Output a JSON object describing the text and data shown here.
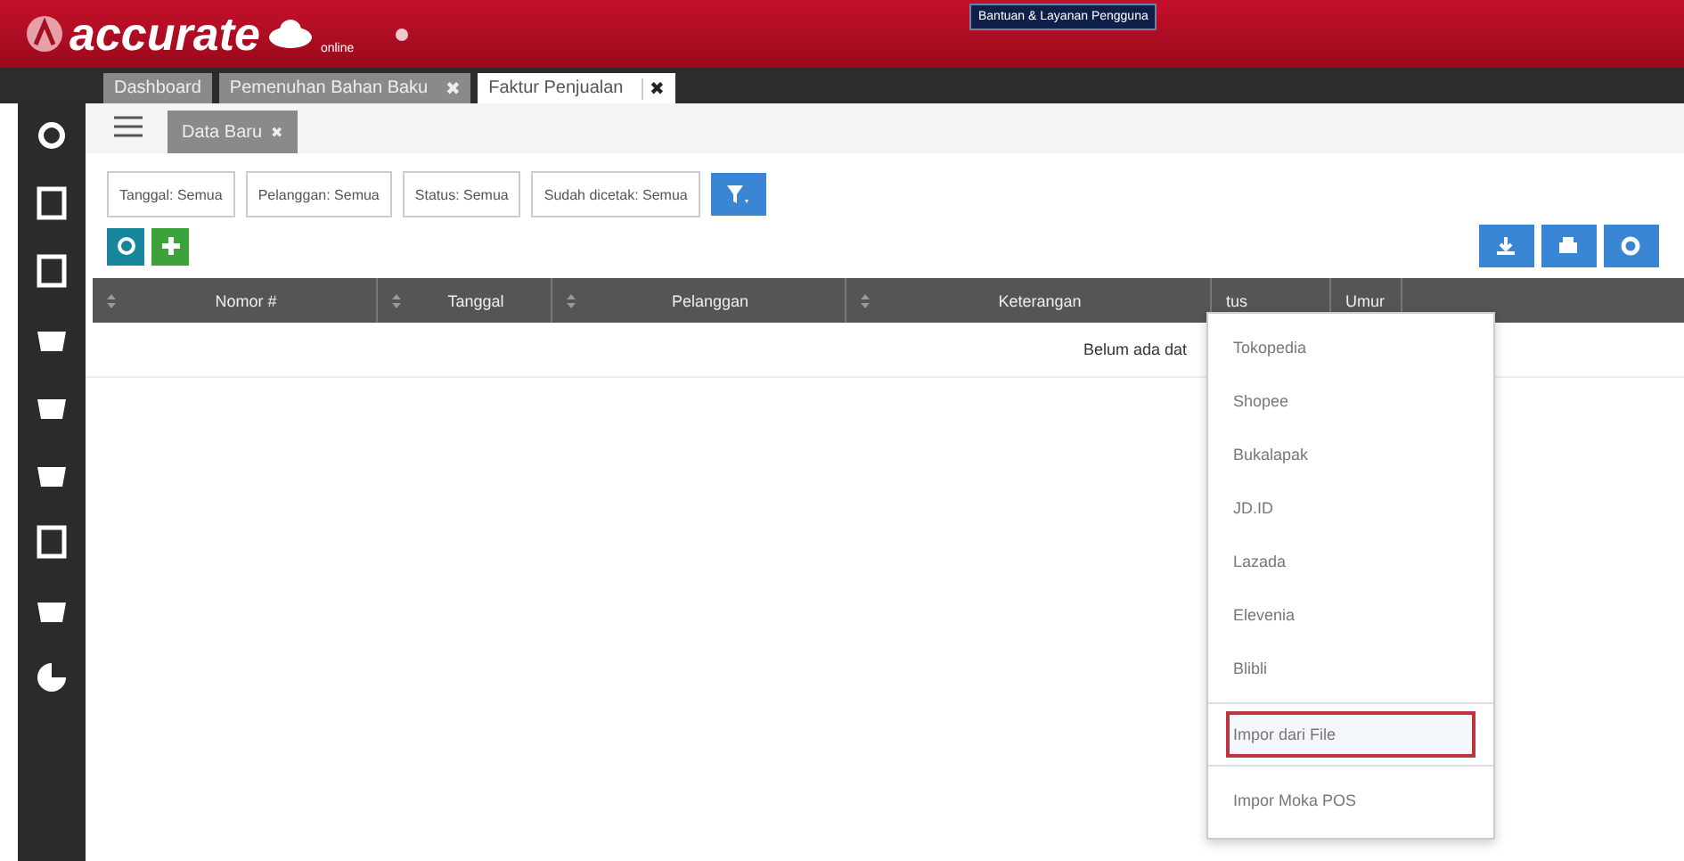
{
  "header": {
    "logo": "accurate",
    "logo_sub": "online",
    "help_button": "Bantuan & Layanan Pengguna"
  },
  "tabs": [
    {
      "label": "Dashboard",
      "selected": false
    },
    {
      "label": "Pemenuhan Bahan Baku",
      "close": "✖",
      "selected": false
    },
    {
      "label": "Faktur Penjualan",
      "close": "✖",
      "selected": true
    }
  ],
  "sub_tab": {
    "label": "Data Baru",
    "close": "✖"
  },
  "filters": [
    "Tanggal: Semua",
    "Pelanggan: Semua",
    "Status: Semua",
    "Sudah dicetak: Semua"
  ],
  "table": {
    "columns": [
      {
        "label": "Nomor #",
        "sortable": true
      },
      {
        "label": "Tanggal",
        "sortable": true
      },
      {
        "label": "Pelanggan",
        "sortable": true
      },
      {
        "label": "Keterangan",
        "sortable": true
      },
      {
        "label": "tus",
        "sortable": false
      },
      {
        "label": "Umur",
        "sortable": false
      }
    ],
    "empty_text": "Belum ada dat"
  },
  "import_menu": {
    "items": [
      {
        "label": "Tokopedia",
        "selected": false
      },
      {
        "label": "Shopee",
        "selected": false
      },
      {
        "label": "Bukalapak",
        "selected": false
      },
      {
        "label": "JD.ID",
        "selected": false
      },
      {
        "label": "Lazada",
        "selected": false
      },
      {
        "label": "Elevenia",
        "selected": false
      },
      {
        "label": "Blibli",
        "selected": false
      },
      {
        "label": "Impor dari File",
        "selected": true
      },
      {
        "label": "Impor Moka POS",
        "selected": false
      }
    ]
  }
}
